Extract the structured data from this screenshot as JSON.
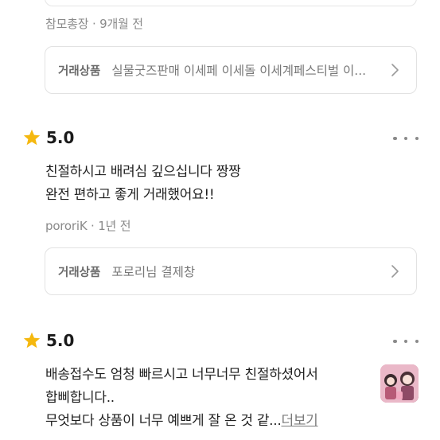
{
  "review1": {
    "meta": "참모총장 · 9개월 전",
    "product_label": "거래상품",
    "product_name": "실물굿즈판매 이세페 이세돌 이세계페스티벌 이..."
  },
  "review2": {
    "score": "5.0",
    "lines": [
      "친절하시고 배려심 깊으십니다 짱짱",
      "완전 편하고 좋게 거래했어요!!"
    ],
    "meta": "pororiK · 1년 전",
    "product_label": "거래상품",
    "product_name": "포로리님 결제창"
  },
  "review3": {
    "score": "5.0",
    "lines": [
      "배송접수도 엄청 빠르시고 너무너무 친절하셨어서",
      "합삐합니다..",
      "무엇보다 상품이 너무 예쁘게 잘 온 것 같..."
    ],
    "read_more": "더보기"
  },
  "icons": {
    "star": "star-icon",
    "more": "more-dots-icon",
    "chevron": "chevron-right-icon",
    "thumbnail": "review-photo-thumbnail"
  },
  "colors": {
    "star": "#F5B80F",
    "border": "#E2E2E2",
    "muted": "#8A8A8A"
  }
}
